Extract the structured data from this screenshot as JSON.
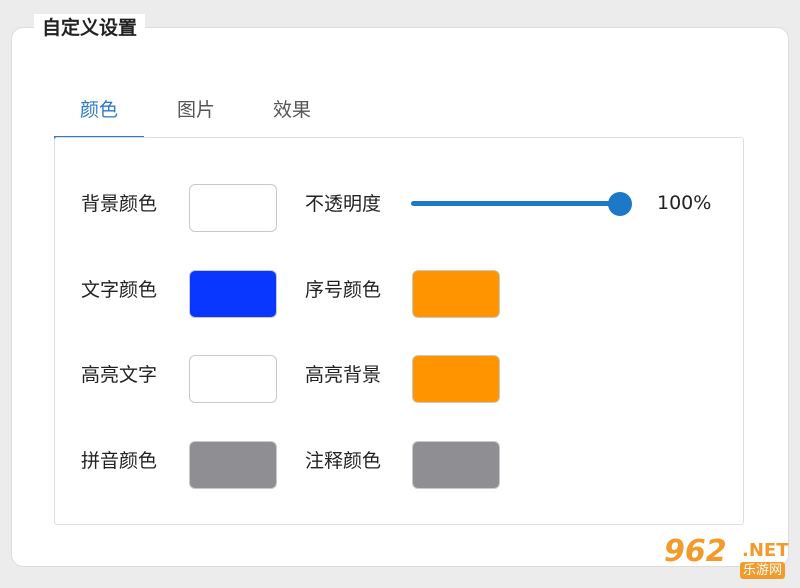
{
  "panel": {
    "title": "自定义设置"
  },
  "tabs": [
    {
      "label": "颜色",
      "active": true
    },
    {
      "label": "图片",
      "active": false
    },
    {
      "label": "效果",
      "active": false
    }
  ],
  "settings": {
    "background_color": {
      "label": "背景颜色",
      "color": "#ffffff"
    },
    "opacity": {
      "label": "不透明度",
      "value_text": "100%",
      "value": 1.0
    },
    "text_color": {
      "label": "文字颜色",
      "color": "#0a37ff"
    },
    "index_color": {
      "label": "序号颜色",
      "color": "#ff9400"
    },
    "highlight_text": {
      "label": "高亮文字",
      "color": "#ffffff"
    },
    "highlight_background": {
      "label": "高亮背景",
      "color": "#ff9400"
    },
    "pinyin_color": {
      "label": "拼音颜色",
      "color": "#8e8e93"
    },
    "annotation_color": {
      "label": "注释颜色",
      "color": "#8e8e93"
    }
  },
  "watermark": {
    "logo": "962",
    "suffix": ".NET",
    "site": "乐游网"
  }
}
